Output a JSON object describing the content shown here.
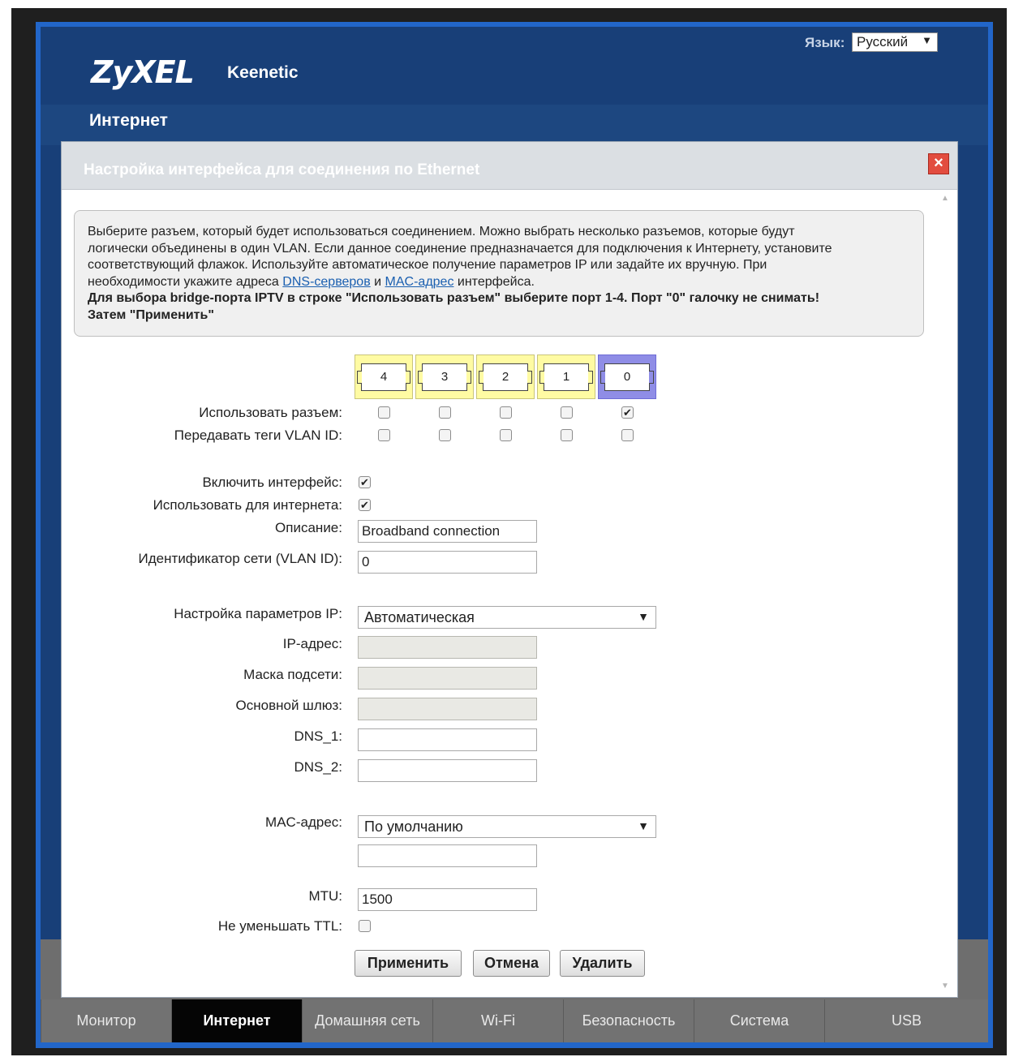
{
  "header": {
    "brand": "ZyXEL",
    "product": "Keenetic",
    "language_label": "Язык:",
    "language_value": "Русский",
    "page_title": "Интернет"
  },
  "modal": {
    "title": "Настройка интерфейса для соединения по Ethernet",
    "info_line1": "Выберите разъем, который будет использоваться соединением. Можно выбрать несколько разъемов, которые будут",
    "info_line2": "логически объединены в один VLAN. Если данное соединение предназначается для подключения к Интернету, установите",
    "info_line3": "соответствующий флажок. Используйте автоматическое получение параметров IP или задайте их вручную. При",
    "info_line4_pre": "необходимости укажите адреса ",
    "info_link_dns": "DNS-серверов",
    "info_and": " и ",
    "info_link_mac": "MAC-адрес",
    "info_line4_post": " интерфейса.",
    "info_bold1": "Для выбора bridge-порта IPTV в строке \"Использовать разъем\" выберите порт 1-4. Порт \"0\" галочку не снимать!",
    "info_bold2": "Затем \"Применить\""
  },
  "ports": [
    {
      "label": "4",
      "use": false,
      "vlan_tags": false
    },
    {
      "label": "3",
      "use": false,
      "vlan_tags": false
    },
    {
      "label": "2",
      "use": false,
      "vlan_tags": false
    },
    {
      "label": "1",
      "use": false,
      "vlan_tags": false
    },
    {
      "label": "0",
      "use": true,
      "vlan_tags": false
    }
  ],
  "form": {
    "use_port_label": "Использовать разъем:",
    "vlan_tags_label": "Передавать теги VLAN ID:",
    "enable_label": "Включить интерфейс:",
    "enable_checked": true,
    "use_internet_label": "Использовать для интернета:",
    "use_internet_checked": true,
    "description_label": "Описание:",
    "description_value": "Broadband connection",
    "vlan_id_label": "Идентификатор сети (VLAN ID):",
    "vlan_id_value": "0",
    "ip_mode_label": "Настройка параметров IP:",
    "ip_mode_value": "Автоматическая",
    "ip_label": "IP-адрес:",
    "mask_label": "Маска подсети:",
    "gateway_label": "Основной шлюз:",
    "dns1_label": "DNS_1:",
    "dns2_label": "DNS_2:",
    "mac_label": "MAC-адрес:",
    "mac_mode_value": "По умолчанию",
    "mtu_label": "MTU:",
    "mtu_value": "1500",
    "ttl_label": "Не уменьшать TTL:",
    "ttl_checked": false
  },
  "buttons": {
    "apply": "Применить",
    "cancel": "Отмена",
    "delete": "Удалить"
  },
  "nav": [
    {
      "label": "Монитор",
      "active": false
    },
    {
      "label": "Интернет",
      "active": true
    },
    {
      "label": "Домашняя сеть",
      "active": false
    },
    {
      "label": "Wi-Fi",
      "active": false
    },
    {
      "label": "Безопасность",
      "active": false
    },
    {
      "label": "Система",
      "active": false
    },
    {
      "label": "USB",
      "active": false
    }
  ],
  "colors": {
    "header_bg": "#183f78",
    "frame_border": "#2266c9",
    "port_default": "#fffba3",
    "port_selected": "#8f8de6",
    "close_button": "#e24c3f",
    "nav_active": "#050505"
  }
}
